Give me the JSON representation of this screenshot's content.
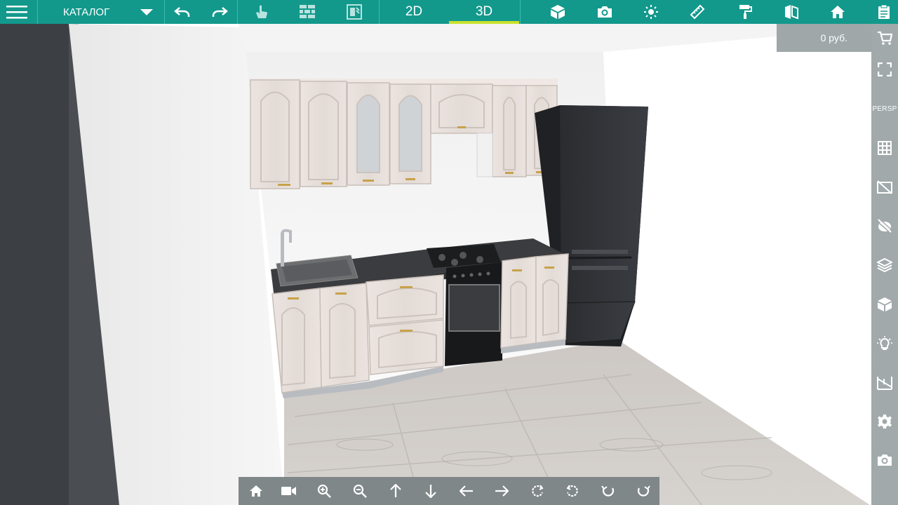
{
  "toolbar": {
    "catalog_label": "КАТАЛОГ",
    "tab_2d": "2D",
    "tab_3d": "3D",
    "active_tab": "3D",
    "accent_color": "#12998c",
    "active_underline_color": "#c9e12e",
    "icons": [
      "menu-icon",
      "undo-icon",
      "redo-icon",
      "hand-icon",
      "brick-wall-icon",
      "door-icon",
      "cube-icon",
      "camera-icon",
      "sun-icon",
      "ruler-icon",
      "paint-roller-icon",
      "room-icon",
      "home-icon",
      "clipboard-icon"
    ]
  },
  "price": {
    "label": "0 руб."
  },
  "right_rail": {
    "persp_label": "PERSP",
    "icons": [
      "cart-icon",
      "fullscreen-icon",
      "grid-icon",
      "hide-walls-icon",
      "texture-icon",
      "layers-icon",
      "box-icon",
      "light-bulb-icon",
      "dimensions-icon",
      "settings-icon",
      "camera-icon"
    ]
  },
  "bottom_nav": {
    "icons": [
      "home-icon",
      "video-camera-icon",
      "zoom-in-icon",
      "zoom-out-icon",
      "arrow-up-icon",
      "arrow-down-icon",
      "arrow-left-icon",
      "arrow-right-icon",
      "rotate-left-icon",
      "rotate-right-icon",
      "tilt-up-icon",
      "tilt-down-icon"
    ]
  }
}
